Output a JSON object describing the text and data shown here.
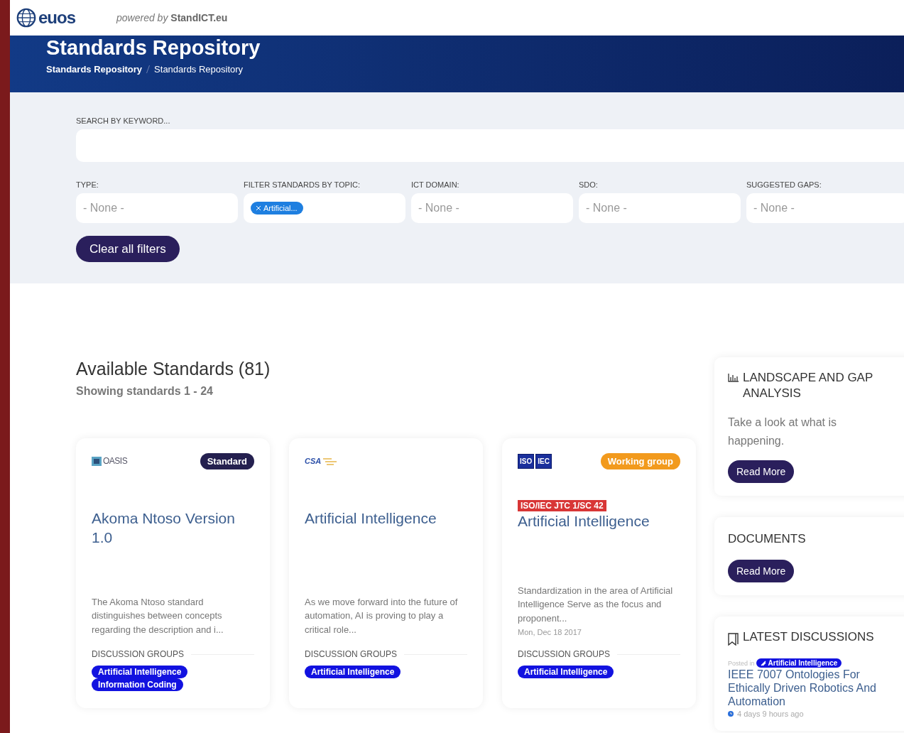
{
  "header": {
    "logo_text": "euos",
    "powered_by": "powered by",
    "powered_brand": "StandICT.eu"
  },
  "banner": {
    "title": "Standards Repository",
    "breadcrumbs": [
      "Standards Repository",
      "Standards Repository"
    ]
  },
  "search": {
    "label": "SEARCH BY KEYWORD..."
  },
  "filters": [
    {
      "label": "TYPE:",
      "value": "- None -"
    },
    {
      "label": "FILTER STANDARDS BY TOPIC:",
      "chips": [
        "Artificial..."
      ]
    },
    {
      "label": "ICT DOMAIN:",
      "value": "- None -"
    },
    {
      "label": "SDO:",
      "value": "- None -"
    },
    {
      "label": "SUGGESTED GAPS:",
      "value": "- None -"
    }
  ],
  "clear_button": "Clear all filters",
  "results": {
    "title": "Available Standards (81)",
    "subtitle": "Showing standards 1 - 24"
  },
  "cards": [
    {
      "logo": {
        "kind": "oasis",
        "texts": [
          "OASIS"
        ]
      },
      "badge": {
        "kind": "standard",
        "label": "Standard"
      },
      "title": "Akoma Ntoso Version 1.0",
      "description": "The Akoma Ntoso standard distinguishes between concepts regarding the description and i...",
      "groups_label": "DISCUSSION GROUPS",
      "groups": [
        "Artificial Intelligence",
        "Information Coding"
      ]
    },
    {
      "logo": {
        "kind": "csa",
        "texts": [
          "CSA"
        ]
      },
      "title": "Artificial Intelligence",
      "description": "As we move forward into the future of automation, AI is proving to play a critical role...",
      "groups_label": "DISCUSSION GROUPS",
      "groups": [
        "Artificial Intelligence"
      ]
    },
    {
      "logo": {
        "kind": "isoiec",
        "texts": [
          "ISO",
          "IEC"
        ]
      },
      "badge": {
        "kind": "working_group",
        "label": "Working group"
      },
      "sdo_tag": "ISO/IEC JTC 1/SC 42",
      "title": "Artificial Intelligence",
      "description": "Standardization in the area of Artificial Intelligence Serve as the focus and proponent...",
      "date": "Mon, Dec 18 2017",
      "groups_label": "DISCUSSION GROUPS",
      "groups": [
        "Artificial Intelligence"
      ]
    }
  ],
  "sidebar": [
    {
      "kind": "landscape",
      "title": "LANDSCAPE AND GAP ANALYSIS",
      "text": "Take a look at what is happening.",
      "button": "Read More"
    },
    {
      "kind": "documents",
      "title": "DOCUMENTS",
      "button": "Read More"
    },
    {
      "kind": "discussions",
      "title": "LATEST DISCUSSIONS",
      "posts": [
        {
          "posted_in": "Posted in",
          "tag": "Artificial Intelligence",
          "title": "IEEE 7007 Ontologies For Ethically Driven Robotics And Automation",
          "time": "4 days 9 hours ago"
        }
      ]
    }
  ]
}
